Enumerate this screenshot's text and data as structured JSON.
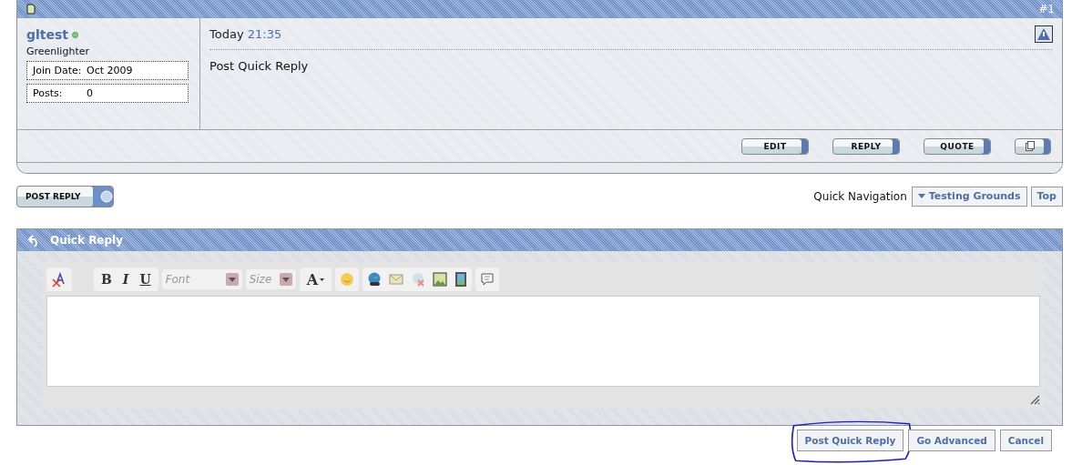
{
  "post": {
    "number": "#1",
    "user": {
      "name": "gltest",
      "online": true,
      "title": "Greenlighter",
      "stats": [
        {
          "label": "Join Date:",
          "value": "Oct 2009"
        },
        {
          "label": "Posts:",
          "value": "0"
        }
      ]
    },
    "date": "Today",
    "time": "21:35",
    "message": "Post Quick Reply",
    "actions": [
      {
        "kind": "text",
        "label": "EDIT"
      },
      {
        "kind": "text",
        "label": "REPLY"
      },
      {
        "kind": "text",
        "label": "QUOTE"
      },
      {
        "kind": "multiquote"
      }
    ]
  },
  "post_reply_button": "POST REPLY",
  "quick_navigation": {
    "label": "Quick Navigation",
    "menu": "Testing Grounds",
    "top": "Top"
  },
  "quick_reply": {
    "title": "Quick Reply",
    "toolbar": {
      "bold": "B",
      "italic": "I",
      "underline": "U",
      "font": "Font",
      "size": "Size",
      "text_color_label": "A"
    },
    "buttons": [
      "Post Quick Reply",
      "Go Advanced",
      "Cancel"
    ]
  }
}
